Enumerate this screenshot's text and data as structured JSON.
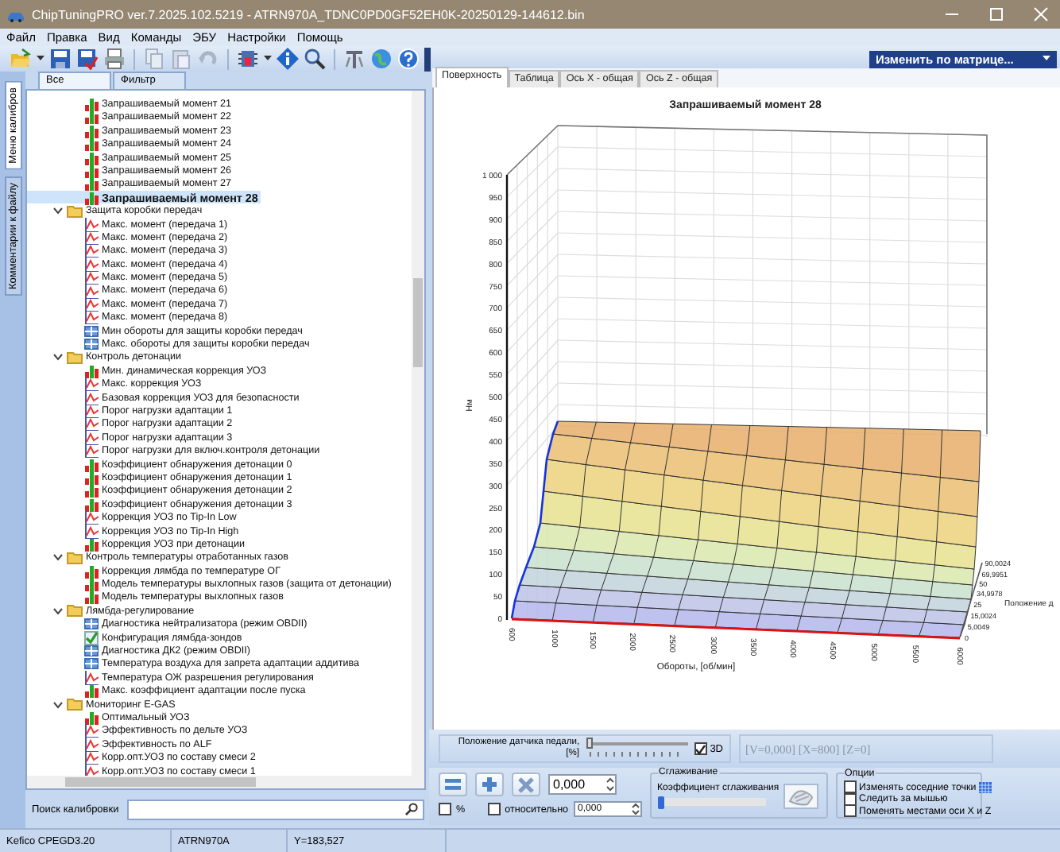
{
  "window": {
    "title": "ChipTuningPRO ver.7.2025.102.5219 - ATRN970A_TDNC0PD0GF52EH0K-20250129-144612.bin"
  },
  "menu": [
    "Файл",
    "Правка",
    "Вид",
    "Команды",
    "ЭБУ",
    "Настройки",
    "Помощь"
  ],
  "toolbar": {
    "matrix_dropdown": "Изменить по матрице..."
  },
  "left_panel": {
    "side_tabs": [
      {
        "label": "Меню калибров",
        "selected": true
      },
      {
        "label": "Комментарии к файлу",
        "selected": false
      }
    ],
    "filter_tabs": [
      {
        "label": "Все",
        "selected": true
      },
      {
        "label": "Фильтр",
        "selected": false
      }
    ],
    "tree_continued": [
      {
        "label": "Запрашиваемый момент 21",
        "kind": "map",
        "selected": false
      },
      {
        "label": "Запрашиваемый момент 22",
        "kind": "map",
        "selected": false
      },
      {
        "label": "Запрашиваемый момент 23",
        "kind": "map",
        "selected": false
      },
      {
        "label": "Запрашиваемый момент 24",
        "kind": "map",
        "selected": false
      },
      {
        "label": "Запрашиваемый момент 25",
        "kind": "map",
        "selected": false
      },
      {
        "label": "Запрашиваемый момент 26",
        "kind": "map",
        "selected": false
      },
      {
        "label": "Запрашиваемый момент 27",
        "kind": "map",
        "selected": false
      },
      {
        "label": "Запрашиваемый момент 28",
        "kind": "map",
        "selected": true
      }
    ],
    "tree": [
      {
        "label": "Защита коробки передач",
        "expanded": true,
        "selected": false,
        "children": [
          {
            "label": "Макс. момент (передача 1)",
            "kind": "curve",
            "selected": false
          },
          {
            "label": "Макс. момент (передача 2)",
            "kind": "curve",
            "selected": false
          },
          {
            "label": "Макс. момент (передача 3)",
            "kind": "curve",
            "selected": false
          },
          {
            "label": "Макс. момент (передача 4)",
            "kind": "curve",
            "selected": false
          },
          {
            "label": "Макс. момент (передача 5)",
            "kind": "curve",
            "selected": false
          },
          {
            "label": "Макс. момент (передача 6)",
            "kind": "curve",
            "selected": false
          },
          {
            "label": "Макс. момент (передача 7)",
            "kind": "curve",
            "selected": false
          },
          {
            "label": "Макс. момент (передача 8)",
            "kind": "curve",
            "selected": false
          },
          {
            "label": "Мин обороты для защиты коробки передач",
            "kind": "table",
            "selected": false
          },
          {
            "label": "Макс. обороты для защиты коробки передач",
            "kind": "table",
            "selected": false
          }
        ]
      },
      {
        "label": "Контроль детонации",
        "expanded": true,
        "selected": false,
        "children": [
          {
            "label": "Мин. динамическая коррекция УОЗ",
            "kind": "map",
            "selected": false
          },
          {
            "label": "Макс. коррекция УОЗ",
            "kind": "curve",
            "selected": false
          },
          {
            "label": "Базовая коррекция УОЗ для безопасности",
            "kind": "curve",
            "selected": false
          },
          {
            "label": "Порог нагрузки адаптации 1",
            "kind": "curve",
            "selected": false
          },
          {
            "label": "Порог нагрузки адаптации 2",
            "kind": "curve",
            "selected": false
          },
          {
            "label": "Порог нагрузки адаптации 3",
            "kind": "curve",
            "selected": false
          },
          {
            "label": "Порог нагрузки для включ.контроля детонации",
            "kind": "curve",
            "selected": false
          },
          {
            "label": "Коэффициент обнаружения детонации 0",
            "kind": "map",
            "selected": false
          },
          {
            "label": "Коэффициент обнаружения детонации 1",
            "kind": "map",
            "selected": false
          },
          {
            "label": "Коэффициент обнаружения детонации 2",
            "kind": "map",
            "selected": false
          },
          {
            "label": "Коэффициент обнаружения детонации 3",
            "kind": "map",
            "selected": false
          },
          {
            "label": "Коррекция УОЗ по Tip-In Low",
            "kind": "curve",
            "selected": false
          },
          {
            "label": "Коррекция УОЗ по Tip-In High",
            "kind": "curve",
            "selected": false
          },
          {
            "label": "Коррекция УОЗ при детонации",
            "kind": "map",
            "selected": false
          }
        ]
      },
      {
        "label": "Контроль температуры отработанных газов",
        "expanded": true,
        "selected": false,
        "children": [
          {
            "label": "Коррекция лямбда по температуре ОГ",
            "kind": "map",
            "selected": false
          },
          {
            "label": "Модель температуры выхлопных газов (защита от детонации)",
            "kind": "map",
            "selected": false
          },
          {
            "label": "Модель температуры выхлопных газов",
            "kind": "map",
            "selected": false
          }
        ]
      },
      {
        "label": "Лямбда-регулирование",
        "expanded": true,
        "selected": false,
        "children": [
          {
            "label": "Диагностика нейтрализатора (режим OBDII)",
            "kind": "table",
            "selected": false
          },
          {
            "label": "Конфигурация лямбда-зондов",
            "kind": "check",
            "selected": false
          },
          {
            "label": "Диагностика ДК2 (режим OBDII)",
            "kind": "table",
            "selected": false
          },
          {
            "label": "Температура воздуха для запрета адаптации аддитива",
            "kind": "table",
            "selected": false
          },
          {
            "label": "Температура ОЖ разрешения регулирования",
            "kind": "curve",
            "selected": false
          },
          {
            "label": "Макс. коэффициент адаптации после пуска",
            "kind": "map",
            "selected": false
          }
        ]
      },
      {
        "label": "Мониторинг E-GAS",
        "expanded": true,
        "selected": false,
        "children": [
          {
            "label": "Оптимальный УОЗ",
            "kind": "map",
            "selected": false
          },
          {
            "label": "Эффективность по дельте УОЗ",
            "kind": "curve",
            "selected": false
          },
          {
            "label": "Эффективность по ALF",
            "kind": "curve",
            "selected": false
          },
          {
            "label": "Корр.опт.УОЗ по составу смеси 2",
            "kind": "curve",
            "selected": false
          },
          {
            "label": "Корр.опт.УОЗ по составу смеси 1",
            "kind": "curve",
            "selected": false
          }
        ]
      }
    ],
    "search": {
      "label": "Поиск калибровки"
    }
  },
  "editor": {
    "tabs": [
      {
        "label": "Поверхность",
        "selected": true
      },
      {
        "label": "Таблица",
        "selected": false
      },
      {
        "label": "Ось X - общая",
        "selected": false
      },
      {
        "label": "Ось Z - общая",
        "selected": false
      }
    ],
    "chart": {
      "title": "Запрашиваемый момент 28",
      "ylabel": "Нм",
      "xlabel": "Обороты, [об/мин]",
      "zlabel": "Положение д",
      "yticks": [
        "1 000",
        "950",
        "900",
        "850",
        "800",
        "750",
        "700",
        "650",
        "600",
        "550",
        "500",
        "450",
        "400",
        "350",
        "300",
        "250",
        "200",
        "150",
        "100",
        "50",
        "0"
      ],
      "xticks": [
        "600",
        "1000",
        "1500",
        "2000",
        "2500",
        "3000",
        "3500",
        "4000",
        "4500",
        "5000",
        "5500",
        "6000"
      ],
      "zticks": [
        "90,0024",
        "69,9951",
        "50",
        "34,9978",
        "25",
        "15,0024",
        "5,0049",
        "0"
      ]
    },
    "slider_panel": {
      "label_line1": "Положение датчика педали,",
      "label_line2": "[%]",
      "level": 0,
      "three_d": {
        "label": "3D",
        "checked": true
      },
      "readout": "[V=0,000] [X=800] [Z=0]"
    },
    "controls": {
      "value": "0,000",
      "percent": {
        "label": "%",
        "checked": false
      },
      "relative": {
        "label": "относительно",
        "checked": false
      },
      "relative_value": "0,000",
      "smoothing": {
        "title": "Сглаживание",
        "label": "Коэффициент сглаживания",
        "level": 0
      },
      "options": {
        "title": "Опции",
        "items": [
          {
            "label": "Изменять соседние точки",
            "checked": false
          },
          {
            "label": "Следить за мышью",
            "checked": false
          },
          {
            "label": "Поменять местами оси X и Z",
            "checked": false
          }
        ]
      }
    }
  },
  "status_bar": [
    "Kefico CPEGD3.20",
    "ATRN970A",
    "Y=183,527"
  ]
}
